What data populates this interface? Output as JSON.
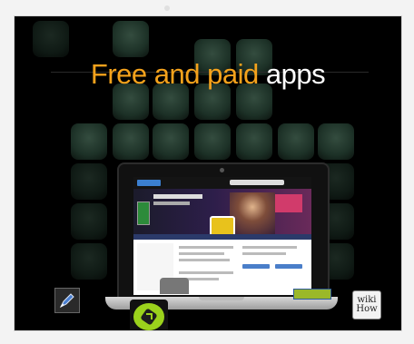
{
  "headline": {
    "part1": "Free and paid",
    "part2": "apps"
  },
  "colors": {
    "headline_accent": "#f4a21c",
    "headline_white": "#ffffff",
    "background": "#000000"
  },
  "icons": {
    "left": "pen-icon",
    "center": "green-app-icon",
    "right": "wiki-how-icon"
  },
  "wiki": {
    "line1": "wiki",
    "line2": "How"
  }
}
